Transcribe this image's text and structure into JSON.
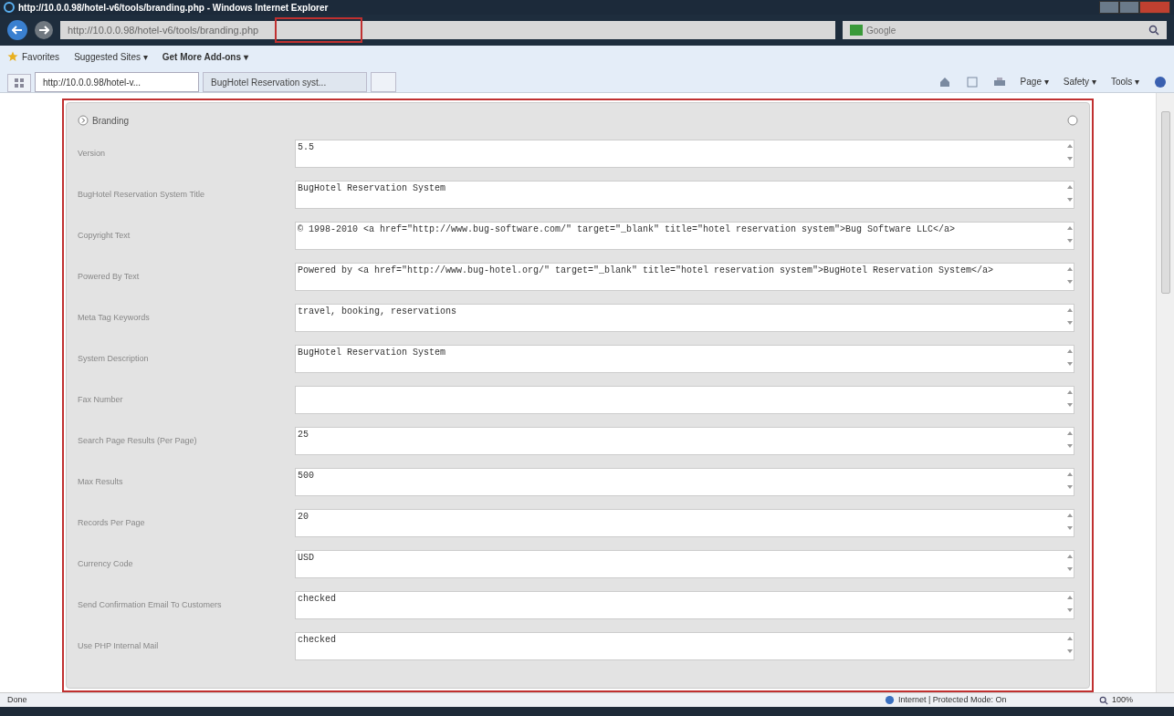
{
  "window": {
    "title": "http://10.0.0.98/hotel-v6/tools/branding.php - Windows Internet Explorer"
  },
  "address_bar": {
    "url": "http://10.0.0.98/hotel-v6/tools/branding.php"
  },
  "search": {
    "placeholder": "Google"
  },
  "favorites_bar": {
    "favorites": "Favorites",
    "items": [
      "Suggested Sites ▾",
      "Get More Add-ons ▾"
    ]
  },
  "tabs": [
    {
      "label": "http://10.0.0.98/hotel-v...",
      "selected": true
    },
    {
      "label": "BugHotel Reservation syst...",
      "selected": false
    }
  ],
  "command_bar": [
    "Page ▾",
    "Safety ▾",
    "Tools ▾"
  ],
  "panel": {
    "title": "Branding",
    "fields": [
      {
        "label": "Version",
        "value": "5.5"
      },
      {
        "label": "BugHotel Reservation System Title",
        "value": "BugHotel Reservation System"
      },
      {
        "label": "Copyright Text",
        "value": "© 1998-2010 <a href=\"http://www.bug-software.com/\" target=\"_blank\" title=\"hotel reservation system\">Bug Software LLC</a>"
      },
      {
        "label": "Powered By Text",
        "value": "Powered by <a href=\"http://www.bug-hotel.org/\" target=\"_blank\" title=\"hotel reservation system\">BugHotel Reservation System</a>"
      },
      {
        "label": "Meta Tag Keywords",
        "value": "travel, booking, reservations"
      },
      {
        "label": "System Description",
        "value": "BugHotel Reservation System"
      },
      {
        "label": "Fax Number"
      },
      {
        "label": "Search Page Results (Per Page)",
        "value": "25"
      },
      {
        "label": "Max Results",
        "value": "500"
      },
      {
        "label": "Records Per Page",
        "value": "20"
      },
      {
        "label": "Currency Code",
        "value": "USD"
      },
      {
        "label": "Send Confirmation Email To Customers",
        "value": "checked"
      },
      {
        "label": "Use PHP Internal Mail",
        "value": "checked"
      }
    ]
  },
  "status_bar": {
    "status": "Done",
    "zone": "Internet | Protected Mode: On",
    "zoom": "100%"
  }
}
